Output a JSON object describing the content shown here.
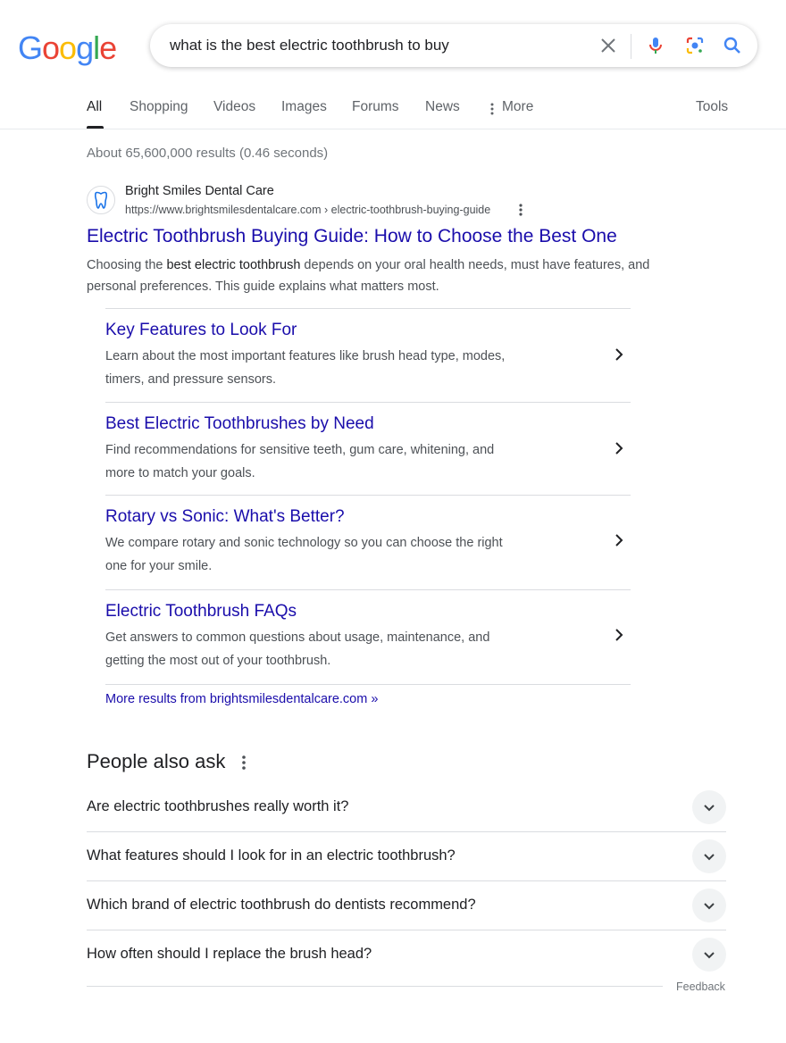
{
  "logo": {
    "letters": [
      "G",
      "o",
      "o",
      "g",
      "l",
      "e"
    ],
    "colors": [
      "#4285F4",
      "#EA4335",
      "#FBBC05",
      "#4285F4",
      "#34A853",
      "#EA4335"
    ]
  },
  "search": {
    "query": "what is the best electric toothbrush to buy",
    "icons": [
      "close-icon",
      "microphone-icon",
      "google-lens-icon",
      "search-icon"
    ]
  },
  "tabs": {
    "items": [
      {
        "label": "All",
        "active": true
      },
      {
        "label": "Shopping"
      },
      {
        "label": "Videos"
      },
      {
        "label": "Images"
      },
      {
        "label": "Forums"
      },
      {
        "label": "News"
      },
      {
        "label": "More"
      }
    ],
    "tools": "Tools"
  },
  "stats": "About 65,600,000 results (0.46 seconds)",
  "result": {
    "site_name": "Bright Smiles Dental Care",
    "url": "https://www.brightsmilesdentalcare.com › electric-toothbrush-buying-guide",
    "title": "Electric Toothbrush Buying Guide: How to Choose the Best One",
    "snippet": {
      "before": "Choosing the ",
      "bold": "best electric toothbrush",
      "after": " depends on your oral health needs, must have features, and personal preferences. This guide explains what matters most."
    },
    "sitelinks": [
      {
        "title": "Key Features to Look For",
        "desc": "Learn about the most important features like brush head type, modes, timers, and pressure sensors."
      },
      {
        "title": "Best Electric Toothbrushes by Need",
        "desc": "Find recommendations for sensitive teeth, gum care, whitening, and more to match your goals."
      },
      {
        "title": "Rotary vs Sonic: What's Better?",
        "desc": "We compare rotary and sonic technology so you can choose the right one for your smile."
      },
      {
        "title": "Electric Toothbrush FAQs",
        "desc": "Get answers to common questions about usage, maintenance, and getting the most out of your toothbrush."
      }
    ],
    "more_results": "More results from brightsmilesdentalcare.com »"
  },
  "paa": {
    "heading": "People also ask",
    "questions": [
      "Are electric toothbrushes really worth it?",
      "What features should I look for in an electric toothbrush?",
      "Which brand of electric toothbrush do dentists recommend?",
      "How often should I replace the brush head?"
    ],
    "feedback": "Feedback"
  },
  "colors": {
    "link": "#1a0dab",
    "text": "#202124",
    "muted": "#4d5156",
    "accent": "#1a73e8"
  }
}
